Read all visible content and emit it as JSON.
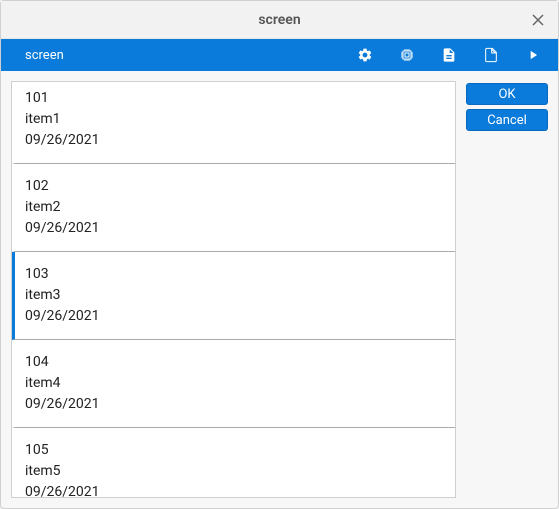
{
  "window": {
    "title": "screen"
  },
  "toolbar": {
    "title": "screen"
  },
  "list": {
    "items": [
      {
        "id": "101",
        "name": "item1",
        "date": "09/26/2021",
        "selected": false
      },
      {
        "id": "102",
        "name": "item2",
        "date": "09/26/2021",
        "selected": false
      },
      {
        "id": "103",
        "name": "item3",
        "date": "09/26/2021",
        "selected": true
      },
      {
        "id": "104",
        "name": "item4",
        "date": "09/26/2021",
        "selected": false
      },
      {
        "id": "105",
        "name": "item5",
        "date": "09/26/2021",
        "selected": false
      }
    ]
  },
  "buttons": {
    "ok": "OK",
    "cancel": "Cancel"
  }
}
